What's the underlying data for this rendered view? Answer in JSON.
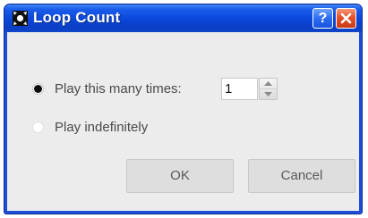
{
  "window": {
    "title": "Loop Count",
    "help_label": "?",
    "icon": "app-icon",
    "close_icon": "close-icon"
  },
  "options": [
    {
      "label": "Play this many times:",
      "selected": true
    },
    {
      "label": "Play indefinitely",
      "selected": false
    }
  ],
  "count": {
    "value": "1",
    "up_icon": "chevron-up-icon",
    "down_icon": "chevron-down-icon"
  },
  "buttons": {
    "ok": "OK",
    "cancel": "Cancel"
  },
  "colors": {
    "titlebar": "#0a46d8",
    "client_background": "#ececec",
    "close_button": "#e5522a"
  }
}
